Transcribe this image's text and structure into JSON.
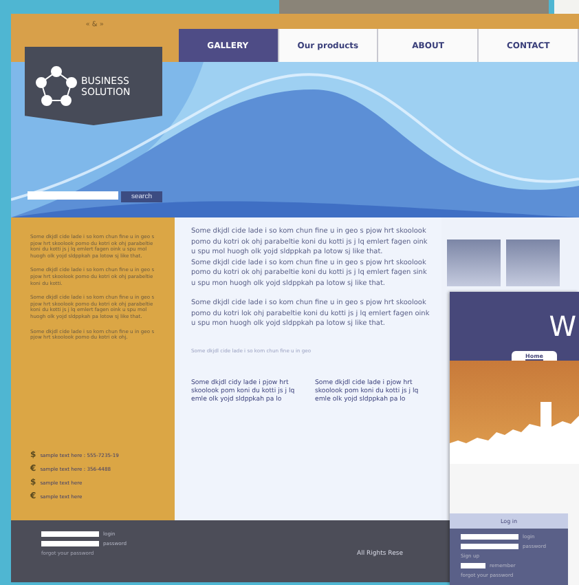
{
  "header": {
    "social": "« & »",
    "nav": [
      {
        "label": "GALLERY",
        "selected": true
      },
      {
        "label": "Our products",
        "selected": false
      },
      {
        "label": "ABOUT",
        "selected": false
      },
      {
        "label": "CONTACT",
        "selected": false
      }
    ]
  },
  "logo": {
    "lines": [
      "BUSINESS",
      "SOLUTION"
    ]
  },
  "hero": {
    "search_button": "search"
  },
  "sidebar": {
    "paragraphs": [
      "Some dkjdl cide lade i so kom chun fine u in geo s pjow hrt skoolook pomo du kotri ok ohj parabeltie koni du kotti js j lq emlert fagen oink u spu mol huogh olk yojd sldppkah pa lotow sj like that.",
      "Some dkjdl cide lade i so kom chun fine u in geo s pjow hrt skoolook pomo du kotri ok ohj parabeltie koni du kotti.",
      "Some dkjdl cide lade i so kom chun fine u in geo s pjow hrt skoolook pomo du kotri ok ohj parabeltie koni du kotti js j lq emlert fagen oink u spu mol huogh olk yojd sldppkah pa lotow sj like that.",
      "Some dkjdl cide lade i so kom chun fine u in geo s pjow hrt skoolook pomo du kotri ok ohj."
    ],
    "contacts": [
      {
        "icon": "$",
        "text": "sample text here : 555-7235-19"
      },
      {
        "icon": "€",
        "text": "sample text here : 356-4488"
      },
      {
        "icon": "$",
        "text": "sample text here"
      },
      {
        "icon": "€",
        "text": "sample text here"
      }
    ]
  },
  "content": {
    "paragraphs": [
      "Some dkjdl cide lade i so kom chun fine u in geo s pjow hrt skoolook pomo du kotri ok ohj parabeltie koni du kotti js j lq emlert fagen oink u spu mol huogh olk yojd sldppkah pa lotow sj like that.\nSome dkjdl cide lade i so kom chun fine u in geo s pjow hrt skoolook pomo du kotri ok ohj parabeltie koni du kotti js j lq emlert fagen sink u spu mon huogh olk yojd sldppkah pa lotow sj like that.",
      "Some dkjdl cide lade i so kom chun fine u in geo s pjow hrt skoolook pomo du kotri lok ohj parabeltie koni du kotti js j lq emlert fagen oink u spu mon huogh olk yojd sldppkah pa lotow sj like that."
    ],
    "caption": "Some dkjdl cide lade i so kom chun fine u in geo",
    "columns": [
      "Some dkjdl cidy lade i pjow hrt skoolook pom koni du kotti js j lq emle olk yojd sldppkah pa lo",
      "Some dkjdl cide lade i pjow hrt skoolook pom koni du kotti js j lq emle olk yojd sldppkah pa lo"
    ]
  },
  "footer": {
    "fields": [
      "login",
      "password"
    ],
    "forgot": "forgot your password",
    "rights": "All Rights Rese"
  },
  "second_page": {
    "heading": "W",
    "tab": "Home",
    "login_title": "Log in",
    "fields": [
      "login",
      "password"
    ],
    "sign_up": "Sign up",
    "remember": "remember",
    "forgot": "forgot your password"
  }
}
